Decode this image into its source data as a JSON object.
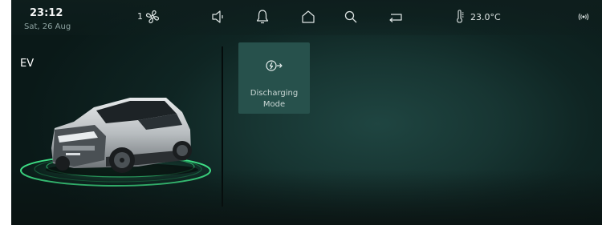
{
  "status_bar": {
    "time": "23:12",
    "date": "Sat, 26 Aug",
    "fan_speed": "1",
    "temperature": "23.0°C",
    "icons": [
      "fan-icon",
      "speaker-icon",
      "bell-icon",
      "home-icon",
      "search-icon",
      "return-icon",
      "thermometer-icon",
      "wireless-signal-icon"
    ]
  },
  "main": {
    "section_title": "EV",
    "cards": [
      {
        "label": "Discharging\nMode",
        "icon": "discharging-bolt-icon"
      }
    ]
  },
  "colors": {
    "background": "#0f2523",
    "card": "#27514c",
    "accent_ring": "#3ddc84"
  }
}
